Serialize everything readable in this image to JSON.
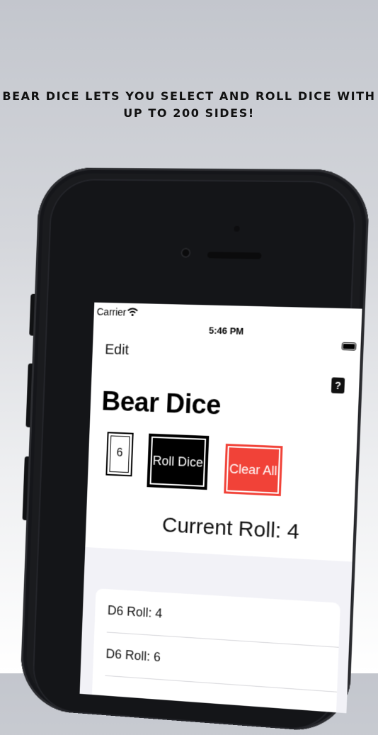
{
  "promo": {
    "line1": "BEAR DICE LETS YOU SELECT AND ROLL DICE WITH",
    "line2": "UP TO 200 SIDES!"
  },
  "status_bar": {
    "carrier": "Carrier",
    "time": "5:46 PM",
    "wifi_icon": "wifi-icon",
    "battery_icon": "battery-icon"
  },
  "nav": {
    "edit_label": "Edit",
    "help_label": "?"
  },
  "app": {
    "title": "Bear Dice",
    "sides_value": "6",
    "roll_label": "Roll Dice",
    "clear_label": "Clear All",
    "current_roll": "Current Roll: 4"
  },
  "rolls": [
    {
      "label": "D6 Roll: 4"
    },
    {
      "label": "D6 Roll: 6"
    }
  ],
  "colors": {
    "clear_button": "#f14238",
    "roll_button": "#000000",
    "list_background": "#f2f2f7"
  }
}
